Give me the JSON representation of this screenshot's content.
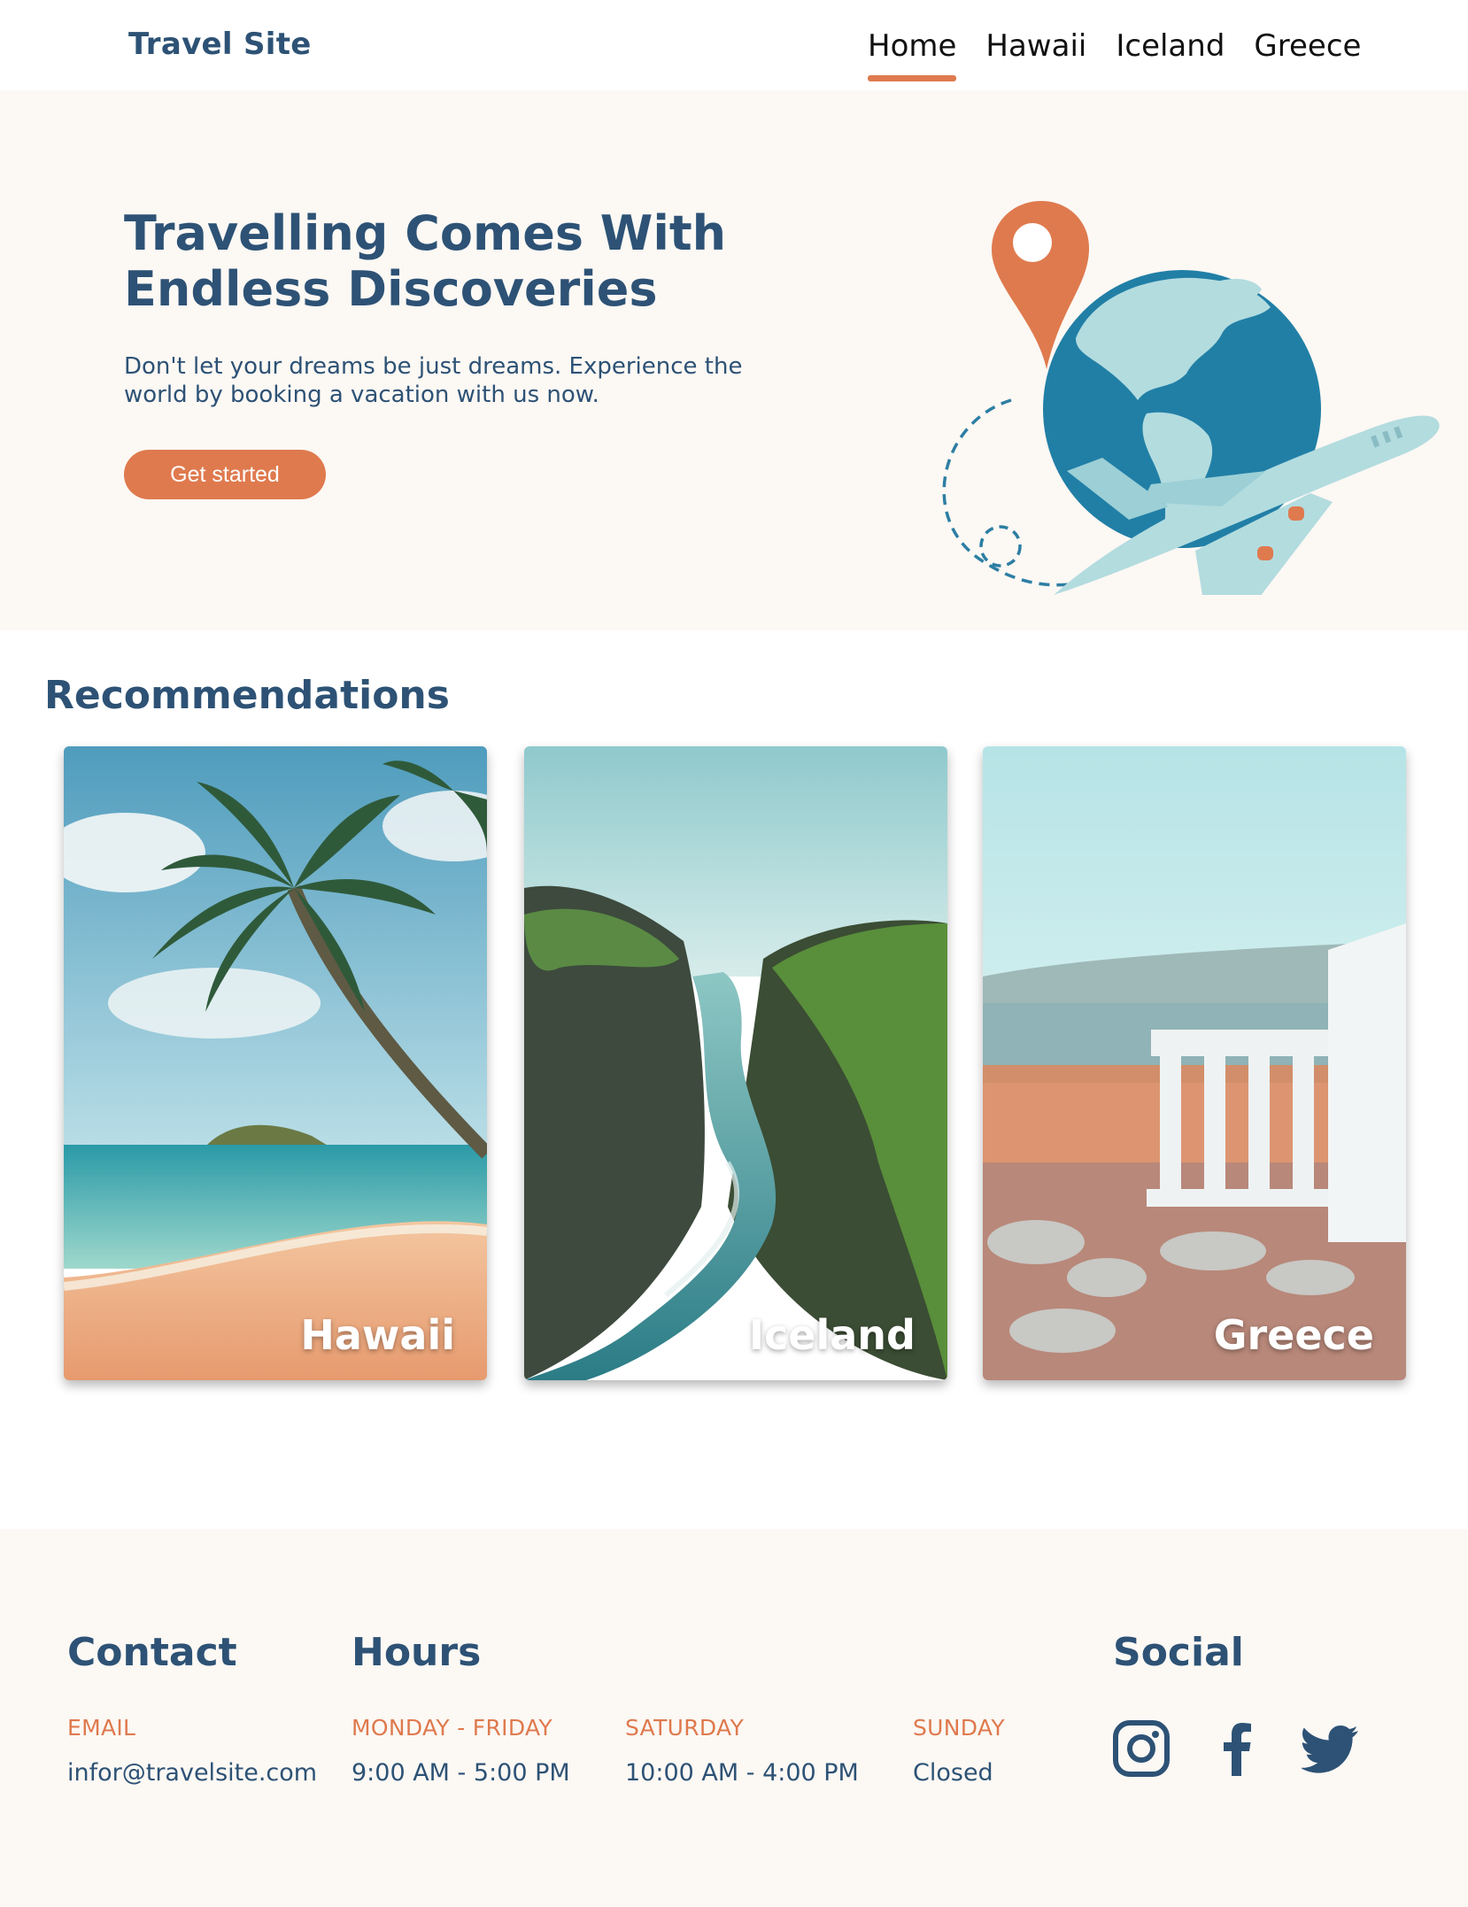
{
  "brand": {
    "name": "Travel Site",
    "primary_color": "#2d5275",
    "accent_color": "#df7a4e",
    "background_tint": "#fcf8f4"
  },
  "nav": {
    "items": [
      {
        "label": "Home",
        "active": true
      },
      {
        "label": "Hawaii",
        "active": false
      },
      {
        "label": "Iceland",
        "active": false
      },
      {
        "label": "Greece",
        "active": false
      }
    ]
  },
  "hero": {
    "title": "Travelling Comes With Endless Discoveries",
    "text": "Don't let your dreams be just dreams. Experience the world by booking a vacation with us now.",
    "cta_label": "Get started",
    "illustration": "globe-with-airplane-and-location-pin"
  },
  "recommendations": {
    "title": "Recommendations",
    "cards": [
      {
        "label": "Hawaii",
        "image": "palm-tree-beach"
      },
      {
        "label": "Iceland",
        "image": "green-canyon-river"
      },
      {
        "label": "Greece",
        "image": "ancient-temple-ruins"
      }
    ]
  },
  "footer": {
    "contact": {
      "title": "Contact",
      "email_label": "EMAIL",
      "email": "infor@travelsite.com"
    },
    "hours": {
      "title": "Hours",
      "days": [
        {
          "label": "MONDAY - FRIDAY",
          "value": "9:00 AM - 5:00 PM"
        },
        {
          "label": "SATURDAY",
          "value": "10:00 AM - 4:00 PM"
        },
        {
          "label": "SUNDAY",
          "value": "Closed"
        }
      ]
    },
    "social": {
      "title": "Social",
      "icons": [
        "instagram-icon",
        "facebook-icon",
        "twitter-icon"
      ]
    }
  }
}
